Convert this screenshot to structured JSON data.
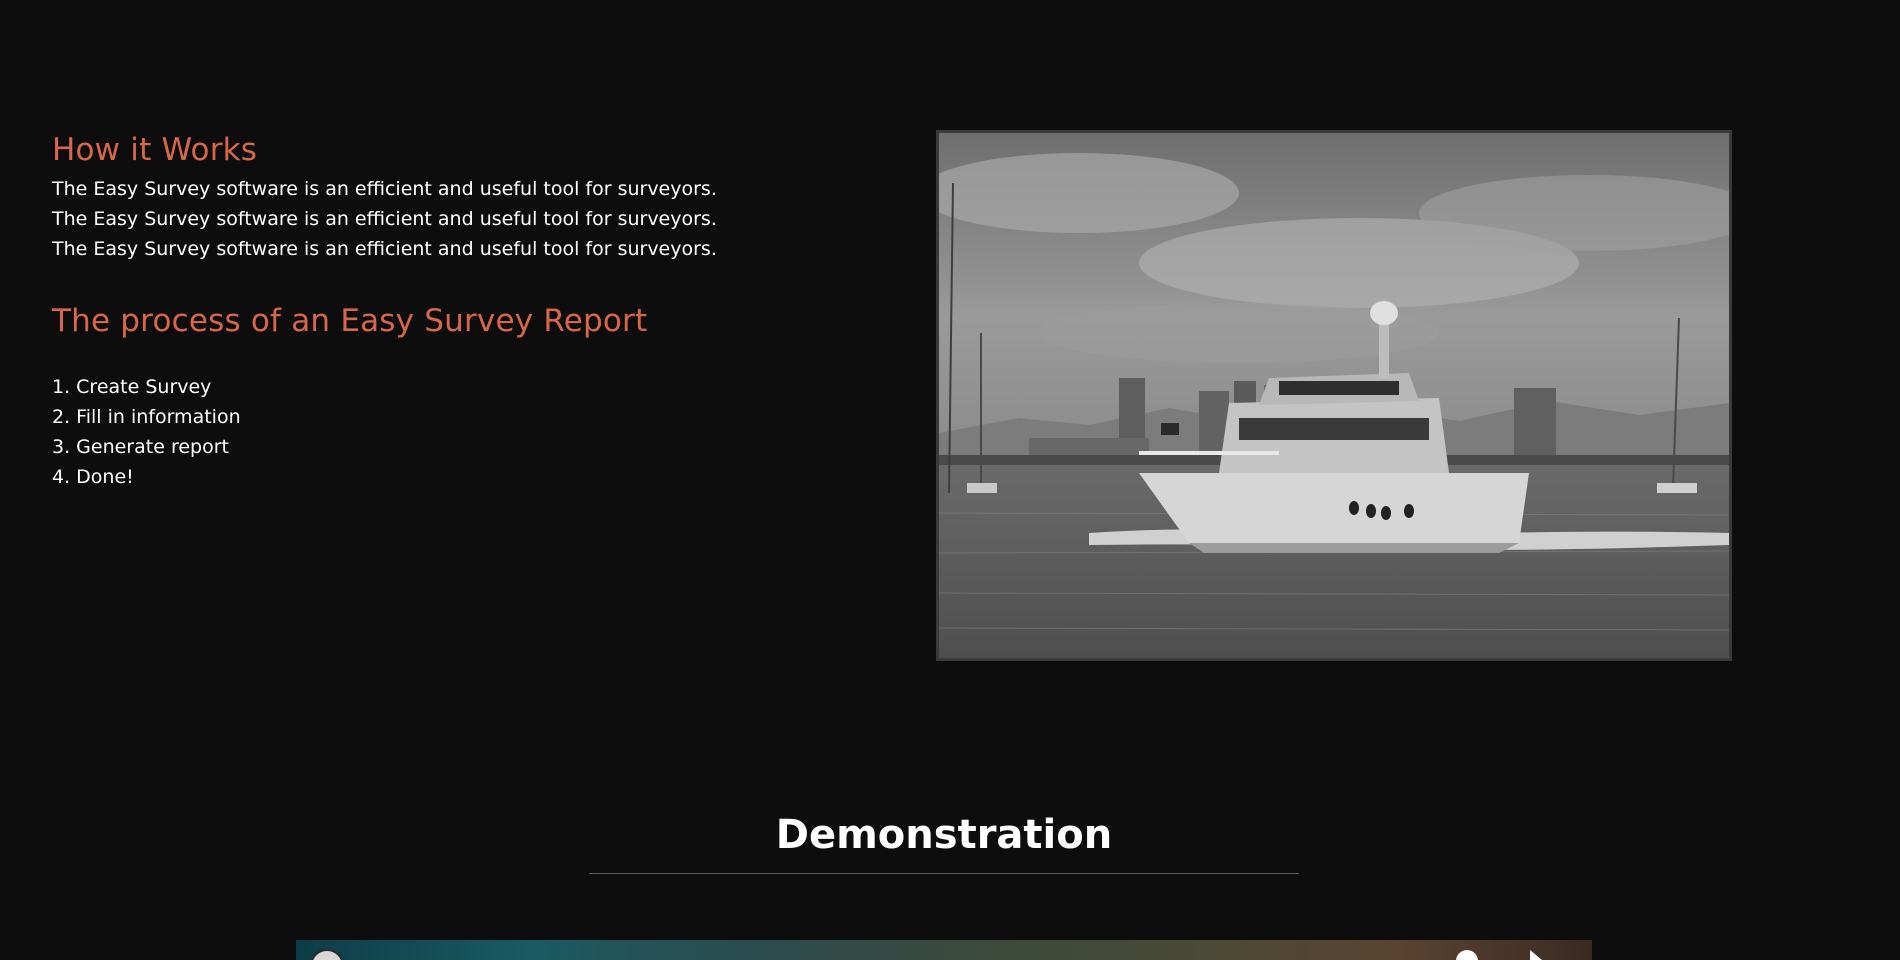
{
  "how_it_works": {
    "heading": "How it Works",
    "body": "The Easy Survey software is an efficient and useful tool for surveyors. The Easy Survey software is an efficient and useful tool for surveyors. The Easy Survey software is an efficient and useful tool for surveyors."
  },
  "process": {
    "heading": "The process of an Easy Survey Report",
    "steps": [
      "1. Create Survey",
      "2. Fill in information",
      "3. Generate report",
      "4. Done!"
    ]
  },
  "demonstration": {
    "heading": "Demonstration"
  },
  "colors": {
    "background": "#0d0d0d",
    "accent": "#d8674a",
    "text": "#ffffff",
    "divider": "#5a5a5a"
  }
}
